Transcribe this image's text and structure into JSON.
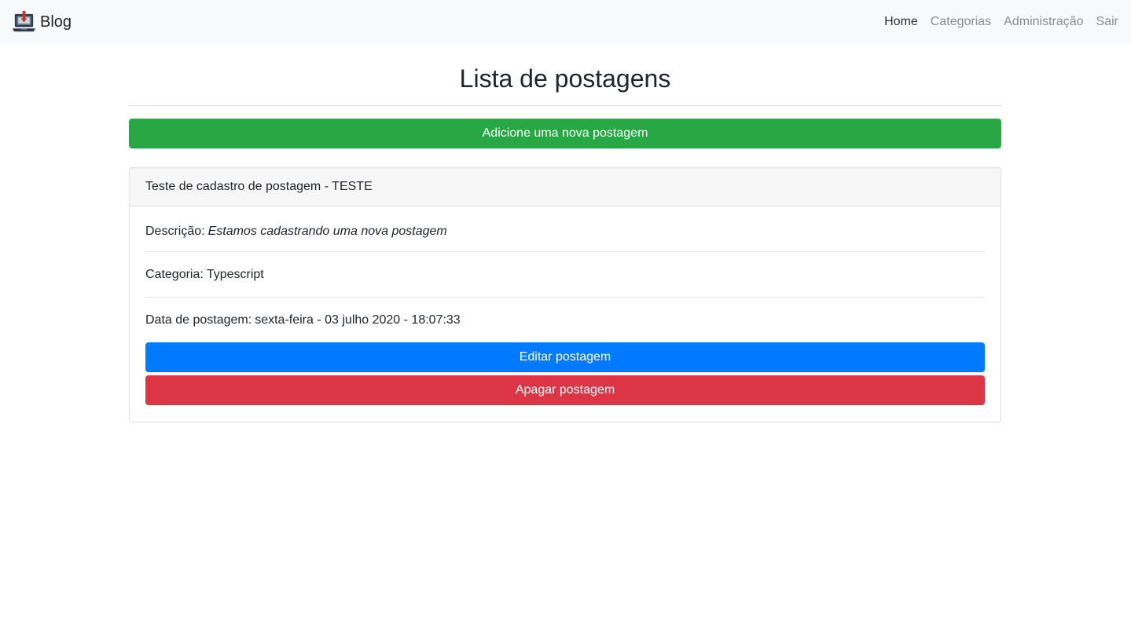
{
  "navbar": {
    "brand": "Blog",
    "brand_icon": "laptop-icon",
    "links": [
      {
        "label": "Home",
        "active": true
      },
      {
        "label": "Categorias",
        "active": false
      },
      {
        "label": "Administração",
        "active": false
      },
      {
        "label": "Sair",
        "active": false
      }
    ]
  },
  "main": {
    "title": "Lista de postagens",
    "add_button": "Adicione uma nova postagem"
  },
  "post": {
    "header": "Teste de cadastro de postagem - TESTE",
    "description_label": "Descrição:",
    "description": "Estamos cadastrando uma nova postagem",
    "category_label": "Categoria:",
    "category": "Typescript",
    "date_label": "Data de postagem:",
    "date": "sexta-feira - 03 julho 2020 - 18:07:33",
    "edit_button": "Editar postagem",
    "delete_button": "Apagar postagem"
  },
  "colors": {
    "success": "#28a745",
    "primary": "#007bff",
    "danger": "#dc3545",
    "navbar_bg": "#f8f9fa"
  }
}
